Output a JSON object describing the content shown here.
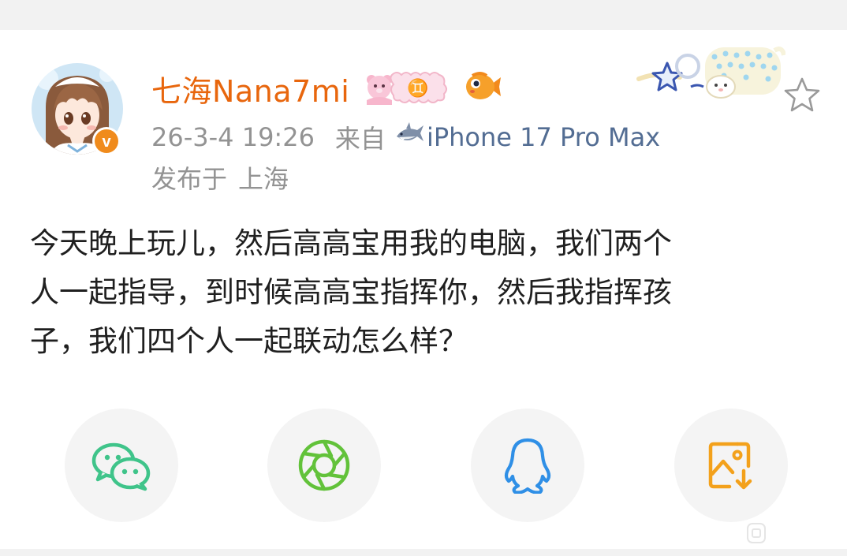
{
  "post": {
    "username": "七海Nana7mi",
    "zodiac_badge": "♊",
    "timestamp": "26-3-4 19:26",
    "source_label": "来自",
    "device": "iPhone 17 Pro Max",
    "location_prefix": "发布于",
    "location": "上海",
    "content": "今天晚上玩儿，然后高高宝用我的电脑，我们两个\n人一起指导，到时候高高宝指挥你，然后我指挥孩\n子，我们四个人一起联动怎么样？"
  },
  "badges": {
    "verified": "v"
  },
  "share": [
    {
      "name": "wechat",
      "icon": "wechat-icon",
      "color": "#3fc48a"
    },
    {
      "name": "moments",
      "icon": "moments-icon",
      "color": "#62c23a"
    },
    {
      "name": "qq",
      "icon": "qq-icon",
      "color": "#2f8fe6"
    },
    {
      "name": "save-image",
      "icon": "save-image-icon",
      "color": "#f3a11b"
    }
  ],
  "colors": {
    "username": "#e8660d",
    "meta": "#939393",
    "device": "#536d93",
    "verified": "#f08b1c"
  }
}
